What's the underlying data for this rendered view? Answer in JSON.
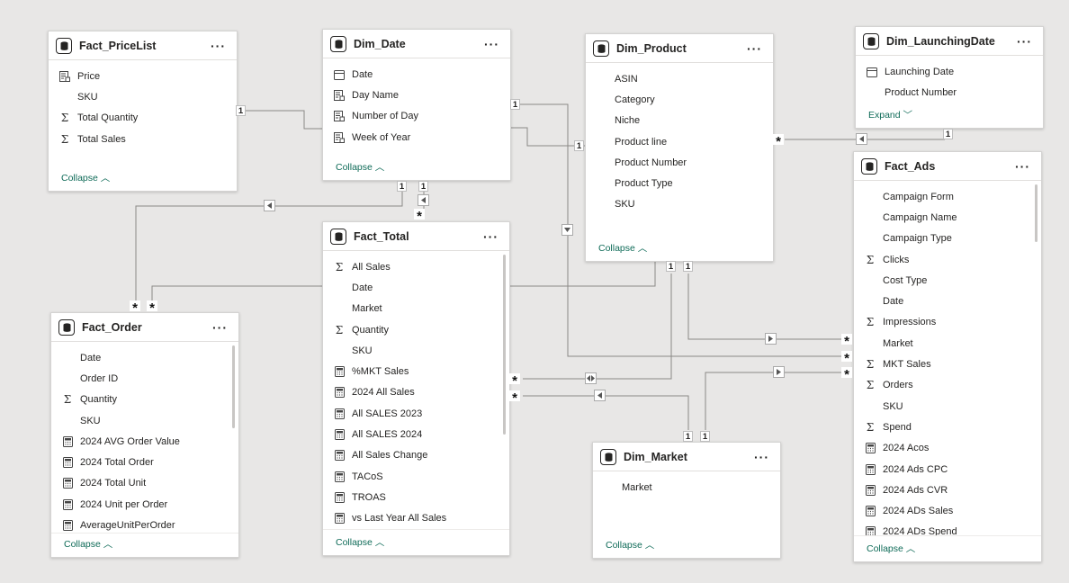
{
  "tables": {
    "pricelist": {
      "title": "Fact_PriceList",
      "fields": [
        {
          "icon": "hierarchy-field-icon",
          "label": "Price"
        },
        {
          "icon": "",
          "label": "SKU"
        },
        {
          "icon": "sum-icon",
          "label": "Total Quantity"
        },
        {
          "icon": "sum-icon",
          "label": "Total Sales"
        }
      ],
      "footer": "Collapse"
    },
    "dim_date": {
      "title": "Dim_Date",
      "fields": [
        {
          "icon": "calendar-icon",
          "label": "Date"
        },
        {
          "icon": "hierarchy-field-icon",
          "label": "Day Name"
        },
        {
          "icon": "hierarchy-field-icon",
          "label": "Number of Day"
        },
        {
          "icon": "hierarchy-field-icon",
          "label": "Week of Year"
        }
      ],
      "footer": "Collapse"
    },
    "dim_product": {
      "title": "Dim_Product",
      "fields": [
        {
          "icon": "",
          "label": "ASIN"
        },
        {
          "icon": "",
          "label": "Category"
        },
        {
          "icon": "",
          "label": "Niche"
        },
        {
          "icon": "",
          "label": "Product line"
        },
        {
          "icon": "",
          "label": "Product Number"
        },
        {
          "icon": "",
          "label": "Product Type"
        },
        {
          "icon": "",
          "label": "SKU"
        }
      ],
      "footer": "Collapse"
    },
    "dim_launching": {
      "title": "Dim_LaunchingDate",
      "fields": [
        {
          "icon": "calendar-icon",
          "label": "Launching Date"
        },
        {
          "icon": "",
          "label": "Product Number"
        }
      ],
      "footer": "Expand"
    },
    "fact_total": {
      "title": "Fact_Total",
      "fields": [
        {
          "icon": "sum-icon",
          "label": "All Sales"
        },
        {
          "icon": "",
          "label": "Date"
        },
        {
          "icon": "",
          "label": "Market"
        },
        {
          "icon": "sum-icon",
          "label": "Quantity"
        },
        {
          "icon": "",
          "label": "SKU"
        },
        {
          "icon": "calculator-icon",
          "label": "%MKT Sales"
        },
        {
          "icon": "calculator-icon",
          "label": "2024 All Sales"
        },
        {
          "icon": "calculator-icon",
          "label": "All SALES 2023"
        },
        {
          "icon": "calculator-icon",
          "label": "All SALES 2024"
        },
        {
          "icon": "calculator-icon",
          "label": "All Sales Change"
        },
        {
          "icon": "calculator-icon",
          "label": "TACoS"
        },
        {
          "icon": "calculator-icon",
          "label": "TROAS"
        },
        {
          "icon": "calculator-icon",
          "label": "vs Last Year All Sales"
        }
      ],
      "footer": "Collapse"
    },
    "fact_order": {
      "title": "Fact_Order",
      "fields": [
        {
          "icon": "",
          "label": "Date"
        },
        {
          "icon": "",
          "label": "Order ID"
        },
        {
          "icon": "sum-icon",
          "label": "Quantity"
        },
        {
          "icon": "",
          "label": "SKU"
        },
        {
          "icon": "calculator-icon",
          "label": "2024 AVG Order Value"
        },
        {
          "icon": "calculator-icon",
          "label": "2024 Total Order"
        },
        {
          "icon": "calculator-icon",
          "label": "2024 Total Unit"
        },
        {
          "icon": "calculator-icon",
          "label": "2024 Unit per Order"
        },
        {
          "icon": "calculator-icon",
          "label": "AverageUnitPerOrder"
        }
      ],
      "footer": "Collapse"
    },
    "dim_market": {
      "title": "Dim_Market",
      "fields": [
        {
          "icon": "",
          "label": "Market"
        }
      ],
      "footer": "Collapse"
    },
    "fact_ads": {
      "title": "Fact_Ads",
      "fields": [
        {
          "icon": "",
          "label": "Campaign Form"
        },
        {
          "icon": "",
          "label": "Campaign Name"
        },
        {
          "icon": "",
          "label": "Campaign Type"
        },
        {
          "icon": "sum-icon",
          "label": "Clicks"
        },
        {
          "icon": "",
          "label": "Cost Type"
        },
        {
          "icon": "",
          "label": "Date"
        },
        {
          "icon": "sum-icon",
          "label": "Impressions"
        },
        {
          "icon": "",
          "label": "Market"
        },
        {
          "icon": "sum-icon",
          "label": "MKT Sales"
        },
        {
          "icon": "sum-icon",
          "label": "Orders"
        },
        {
          "icon": "",
          "label": "SKU"
        },
        {
          "icon": "sum-icon",
          "label": "Spend"
        },
        {
          "icon": "calculator-icon",
          "label": "2024 Acos"
        },
        {
          "icon": "calculator-icon",
          "label": "2024 Ads CPC"
        },
        {
          "icon": "calculator-icon",
          "label": "2024 Ads CVR"
        },
        {
          "icon": "calculator-icon",
          "label": "2024 ADs Sales"
        },
        {
          "icon": "calculator-icon",
          "label": "2024 ADs Spend"
        }
      ],
      "footer": "Collapse"
    }
  },
  "cardinality": {
    "one": "1",
    "many": "*"
  },
  "colors": {
    "line": "#8a8886",
    "footer_link": "#0f6b58",
    "background": "#e8e7e6"
  }
}
